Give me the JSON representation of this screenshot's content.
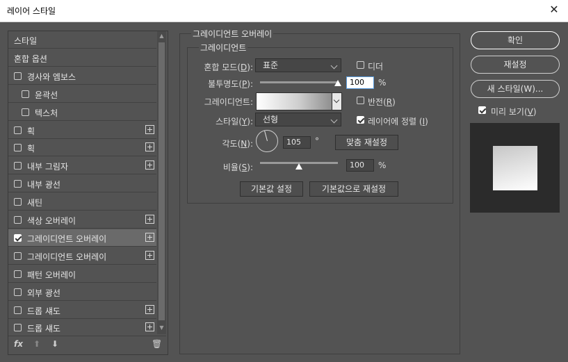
{
  "window": {
    "title": "레이어 스타일",
    "close": "✕"
  },
  "sidebar": {
    "items": [
      {
        "label": "스타일",
        "check": false,
        "plus": false,
        "has_checkbox": false,
        "indent": 0
      },
      {
        "label": "혼합 옵션",
        "check": false,
        "plus": false,
        "has_checkbox": false,
        "indent": 0
      },
      {
        "label": "경사와 엠보스",
        "check": false,
        "plus": false,
        "has_checkbox": true,
        "indent": 0
      },
      {
        "label": "윤곽선",
        "check": false,
        "plus": false,
        "has_checkbox": true,
        "indent": 1
      },
      {
        "label": "텍스처",
        "check": false,
        "plus": false,
        "has_checkbox": true,
        "indent": 1
      },
      {
        "label": "획",
        "check": false,
        "plus": true,
        "has_checkbox": true,
        "indent": 0
      },
      {
        "label": "획",
        "check": false,
        "plus": true,
        "has_checkbox": true,
        "indent": 0
      },
      {
        "label": "내부 그림자",
        "check": false,
        "plus": true,
        "has_checkbox": true,
        "indent": 0
      },
      {
        "label": "내부 광선",
        "check": false,
        "plus": false,
        "has_checkbox": true,
        "indent": 0
      },
      {
        "label": "새틴",
        "check": false,
        "plus": false,
        "has_checkbox": true,
        "indent": 0
      },
      {
        "label": "색상 오버레이",
        "check": false,
        "plus": true,
        "has_checkbox": true,
        "indent": 0
      },
      {
        "label": "그레이디언트 오버레이",
        "check": true,
        "plus": true,
        "has_checkbox": true,
        "indent": 0,
        "selected": true
      },
      {
        "label": "그레이디언트 오버레이",
        "check": false,
        "plus": true,
        "has_checkbox": true,
        "indent": 0
      },
      {
        "label": "패턴 오버레이",
        "check": false,
        "plus": false,
        "has_checkbox": true,
        "indent": 0
      },
      {
        "label": "외부 광선",
        "check": false,
        "plus": false,
        "has_checkbox": true,
        "indent": 0
      },
      {
        "label": "드롭 섀도",
        "check": false,
        "plus": true,
        "has_checkbox": true,
        "indent": 0
      },
      {
        "label": "드롭 섀도",
        "check": false,
        "plus": true,
        "has_checkbox": true,
        "indent": 0
      }
    ],
    "tools": {
      "fx": "fx",
      "up": "⬆",
      "down": "⬇",
      "trash": "🗑"
    }
  },
  "panel": {
    "group_title": "그레이디언트 오버레이",
    "sub_title": "그레이디언트",
    "blend_mode": {
      "label": "혼합 모드",
      "key": "D",
      "value": "표준"
    },
    "dither": {
      "label": "디더",
      "checked": false
    },
    "opacity": {
      "label": "불투명도",
      "key": "P",
      "value": "100",
      "unit": "%",
      "level": 1.0
    },
    "gradient": {
      "label": "그레이디언트:"
    },
    "reverse": {
      "label": "반전",
      "key": "R",
      "checked": false
    },
    "style": {
      "label": "스타일",
      "key": "Y",
      "value": "선형"
    },
    "align": {
      "label": "레이어에 정렬",
      "key": "I",
      "checked": true
    },
    "angle": {
      "label": "각도",
      "key": "N",
      "value": "105",
      "unit": "°"
    },
    "reset_align": "맞춤 재설정",
    "scale": {
      "label": "비율",
      "key": "S",
      "value": "100",
      "unit": "%",
      "level": 0.5
    },
    "make_default": "기본값 설정",
    "reset_default": "기본값으로 재설정"
  },
  "right": {
    "ok": "확인",
    "reset": "재설정",
    "new_style": "새 스타일(W)...",
    "preview": {
      "label": "미리 보기",
      "key": "V",
      "checked": true
    }
  },
  "colors": {
    "bg": "#535353",
    "selected": "#6a6a6a",
    "field": "#464646"
  }
}
